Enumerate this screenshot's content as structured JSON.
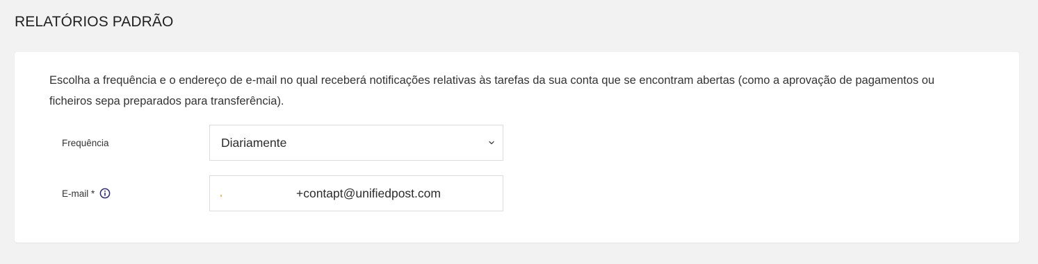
{
  "section": {
    "title": "RELATÓRIOS PADRÃO"
  },
  "card": {
    "description": "Escolha a frequência e o endereço de e-mail no qual receberá notificações relativas às tarefas da sua conta que se encontram abertas (como a aprovação de pagamentos ou ficheiros sepa preparados para transferência)."
  },
  "form": {
    "frequency": {
      "label": "Frequência",
      "selected_value": "Diariamente",
      "icon": "chevron-down-icon"
    },
    "email": {
      "label": "E-mail *",
      "value": "+contapt@unifiedpost.com",
      "icon": "info-icon"
    }
  },
  "colors": {
    "background": "#f2f2f2",
    "card": "#ffffff",
    "border": "#dcdcdc",
    "info_icon": "#2d2a6e"
  }
}
